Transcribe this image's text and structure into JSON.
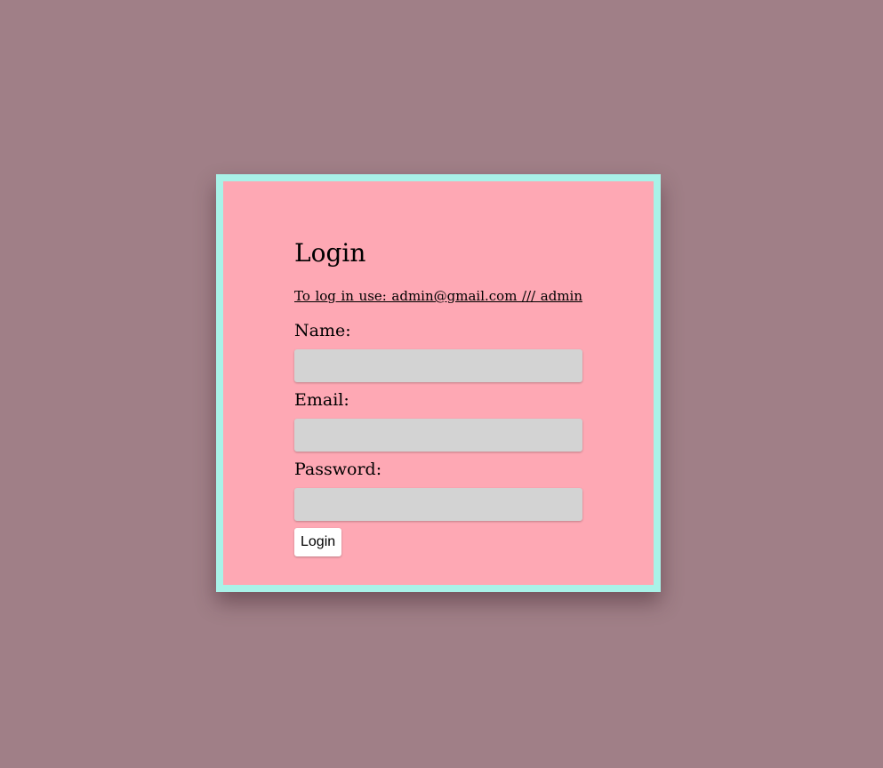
{
  "login_form": {
    "title": "Login",
    "hint": "To log in use: admin@gmail.com /// admin",
    "name_label": "Name:",
    "name_value": "",
    "email_label": "Email:",
    "email_value": "",
    "password_label": "Password:",
    "password_value": "",
    "submit_label": "Login"
  },
  "colors": {
    "page_background": "#a07f87",
    "card_background": "#fea8b4",
    "card_border": "#a9f2e8",
    "input_background": "#d3d3d3",
    "button_background": "#ffffff"
  }
}
